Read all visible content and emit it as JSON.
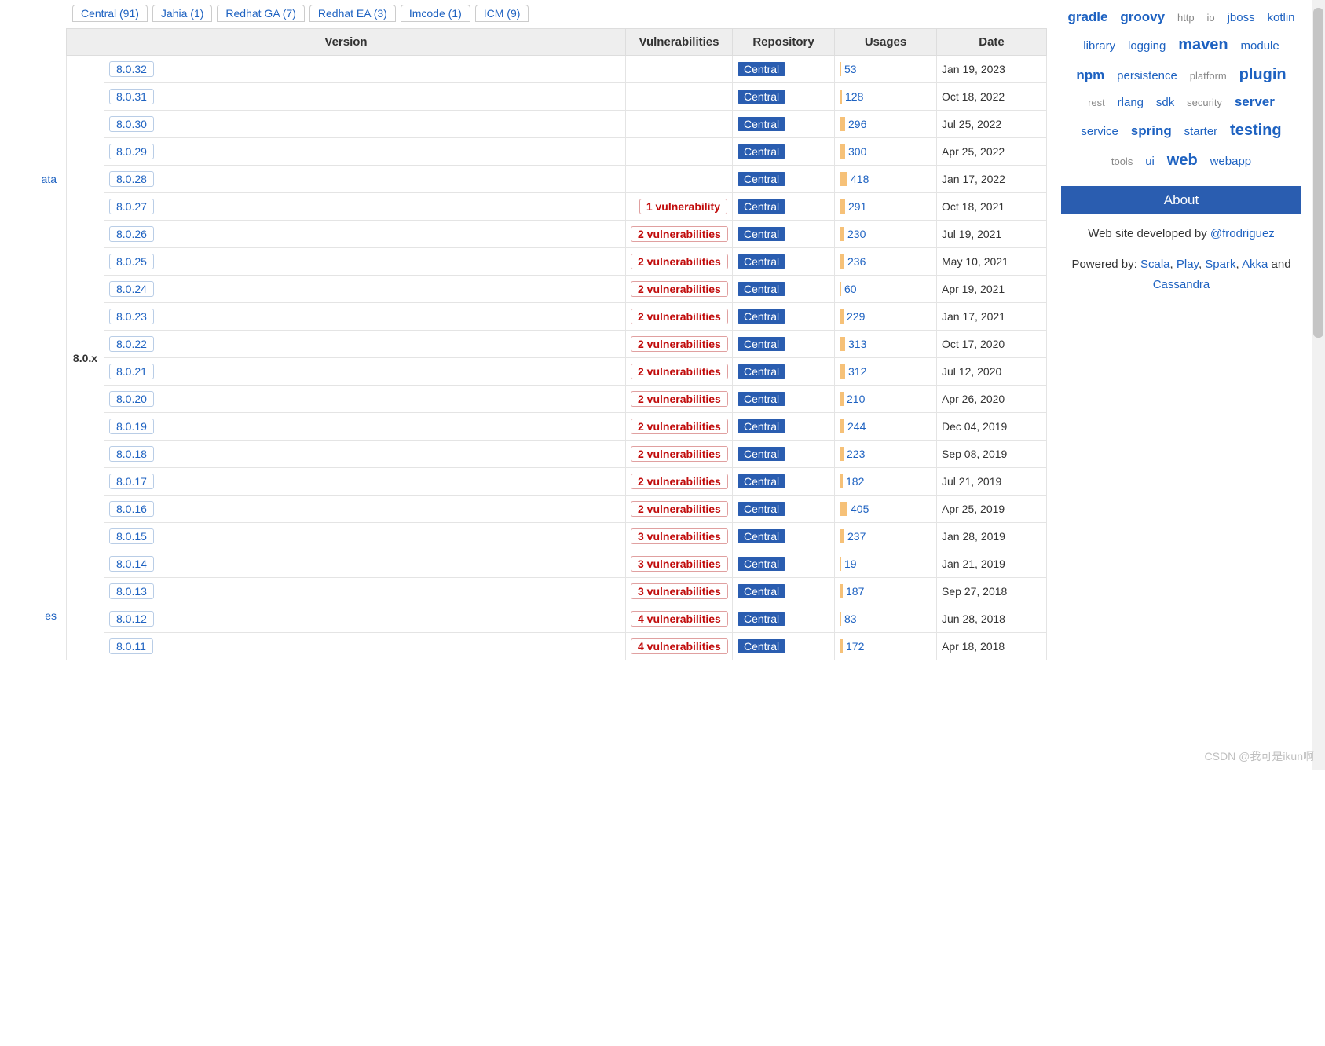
{
  "sidewords": [
    "ata",
    "es"
  ],
  "tabs": [
    "Central (91)",
    "Jahia (1)",
    "Redhat GA (7)",
    "Redhat EA (3)",
    "Imcode (1)",
    "ICM (9)"
  ],
  "columns": [
    "Version",
    "Vulnerabilities",
    "Repository",
    "Usages",
    "Date"
  ],
  "branch_label": "8.0.x",
  "max_usages": 418,
  "rows": [
    {
      "version": "8.0.32",
      "vuln": "",
      "repo": "Central",
      "usages": 53,
      "date": "Jan 19, 2023"
    },
    {
      "version": "8.0.31",
      "vuln": "",
      "repo": "Central",
      "usages": 128,
      "date": "Oct 18, 2022"
    },
    {
      "version": "8.0.30",
      "vuln": "",
      "repo": "Central",
      "usages": 296,
      "date": "Jul 25, 2022"
    },
    {
      "version": "8.0.29",
      "vuln": "",
      "repo": "Central",
      "usages": 300,
      "date": "Apr 25, 2022"
    },
    {
      "version": "8.0.28",
      "vuln": "",
      "repo": "Central",
      "usages": 418,
      "date": "Jan 17, 2022"
    },
    {
      "version": "8.0.27",
      "vuln": "1 vulnerability",
      "repo": "Central",
      "usages": 291,
      "date": "Oct 18, 2021"
    },
    {
      "version": "8.0.26",
      "vuln": "2 vulnerabilities",
      "repo": "Central",
      "usages": 230,
      "date": "Jul 19, 2021"
    },
    {
      "version": "8.0.25",
      "vuln": "2 vulnerabilities",
      "repo": "Central",
      "usages": 236,
      "date": "May 10, 2021"
    },
    {
      "version": "8.0.24",
      "vuln": "2 vulnerabilities",
      "repo": "Central",
      "usages": 60,
      "date": "Apr 19, 2021"
    },
    {
      "version": "8.0.23",
      "vuln": "2 vulnerabilities",
      "repo": "Central",
      "usages": 229,
      "date": "Jan 17, 2021"
    },
    {
      "version": "8.0.22",
      "vuln": "2 vulnerabilities",
      "repo": "Central",
      "usages": 313,
      "date": "Oct 17, 2020"
    },
    {
      "version": "8.0.21",
      "vuln": "2 vulnerabilities",
      "repo": "Central",
      "usages": 312,
      "date": "Jul 12, 2020"
    },
    {
      "version": "8.0.20",
      "vuln": "2 vulnerabilities",
      "repo": "Central",
      "usages": 210,
      "date": "Apr 26, 2020"
    },
    {
      "version": "8.0.19",
      "vuln": "2 vulnerabilities",
      "repo": "Central",
      "usages": 244,
      "date": "Dec 04, 2019"
    },
    {
      "version": "8.0.18",
      "vuln": "2 vulnerabilities",
      "repo": "Central",
      "usages": 223,
      "date": "Sep 08, 2019"
    },
    {
      "version": "8.0.17",
      "vuln": "2 vulnerabilities",
      "repo": "Central",
      "usages": 182,
      "date": "Jul 21, 2019"
    },
    {
      "version": "8.0.16",
      "vuln": "2 vulnerabilities",
      "repo": "Central",
      "usages": 405,
      "date": "Apr 25, 2019"
    },
    {
      "version": "8.0.15",
      "vuln": "3 vulnerabilities",
      "repo": "Central",
      "usages": 237,
      "date": "Jan 28, 2019"
    },
    {
      "version": "8.0.14",
      "vuln": "3 vulnerabilities",
      "repo": "Central",
      "usages": 19,
      "date": "Jan 21, 2019"
    },
    {
      "version": "8.0.13",
      "vuln": "3 vulnerabilities",
      "repo": "Central",
      "usages": 187,
      "date": "Sep 27, 2018"
    },
    {
      "version": "8.0.12",
      "vuln": "4 vulnerabilities",
      "repo": "Central",
      "usages": 83,
      "date": "Jun 28, 2018"
    },
    {
      "version": "8.0.11",
      "vuln": "4 vulnerabilities",
      "repo": "Central",
      "usages": 172,
      "date": "Apr 18, 2018"
    }
  ],
  "tags": [
    {
      "t": "gradle",
      "w": 3
    },
    {
      "t": "groovy",
      "w": 3
    },
    {
      "t": "http",
      "w": 1,
      "m": 1
    },
    {
      "t": "io",
      "w": 1,
      "m": 1
    },
    {
      "t": "jboss",
      "w": 2
    },
    {
      "t": "kotlin",
      "w": 2
    },
    {
      "t": "library",
      "w": 2
    },
    {
      "t": "logging",
      "w": 2
    },
    {
      "t": "maven",
      "w": 4
    },
    {
      "t": "module",
      "w": 2
    },
    {
      "t": "npm",
      "w": 3
    },
    {
      "t": "persistence",
      "w": 2
    },
    {
      "t": "platform",
      "w": 1,
      "m": 1
    },
    {
      "t": "plugin",
      "w": 4
    },
    {
      "t": "rest",
      "w": 1,
      "m": 1
    },
    {
      "t": "rlang",
      "w": 2
    },
    {
      "t": "sdk",
      "w": 2
    },
    {
      "t": "security",
      "w": 1,
      "m": 1
    },
    {
      "t": "server",
      "w": 3
    },
    {
      "t": "service",
      "w": 2
    },
    {
      "t": "spring",
      "w": 3
    },
    {
      "t": "starter",
      "w": 2
    },
    {
      "t": "testing",
      "w": 4
    },
    {
      "t": "tools",
      "w": 1,
      "m": 1
    },
    {
      "t": "ui",
      "w": 2
    },
    {
      "t": "web",
      "w": 4
    },
    {
      "t": "webapp",
      "w": 2
    }
  ],
  "about": {
    "header": "About",
    "line1_pre": "Web site developed by ",
    "line1_link": "@frodriguez",
    "line2_pre": "Powered by: ",
    "links": [
      "Scala",
      "Play",
      "Spark",
      "Akka"
    ],
    "line2_post": " and ",
    "line2_last": "Cassandra"
  },
  "watermark": "CSDN @我可是ikun啊"
}
